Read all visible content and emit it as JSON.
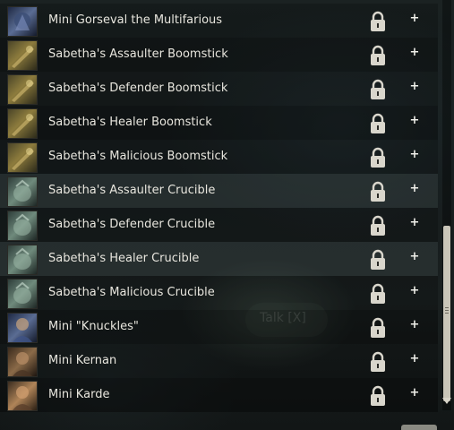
{
  "world": {
    "talk_prompt": "Talk [X]"
  },
  "items": [
    {
      "name": "Mini Gorseval the Multifarious",
      "icon": "gorseval-icon",
      "tone": "blue"
    },
    {
      "name": "Sabetha's Assaulter Boomstick",
      "icon": "boomstick-icon",
      "tone": "gold"
    },
    {
      "name": "Sabetha's Defender Boomstick",
      "icon": "boomstick-icon",
      "tone": "gold"
    },
    {
      "name": "Sabetha's Healer Boomstick",
      "icon": "boomstick-icon",
      "tone": "gold"
    },
    {
      "name": "Sabetha's Malicious Boomstick",
      "icon": "boomstick-icon",
      "tone": "gold"
    },
    {
      "name": "Sabetha's Assaulter Crucible",
      "icon": "crucible-icon",
      "tone": "teal"
    },
    {
      "name": "Sabetha's Defender Crucible",
      "icon": "crucible-icon",
      "tone": "teal"
    },
    {
      "name": "Sabetha's Healer Crucible",
      "icon": "crucible-icon",
      "tone": "teal"
    },
    {
      "name": "Sabetha's Malicious Crucible",
      "icon": "crucible-icon",
      "tone": "teal"
    },
    {
      "name": "Mini \"Knuckles\"",
      "icon": "knuckles-portrait-icon",
      "tone": "blue"
    },
    {
      "name": "Mini Kernan",
      "icon": "kernan-portrait-icon",
      "tone": "brown"
    },
    {
      "name": "Mini Karde",
      "icon": "karde-portrait-icon",
      "tone": "skin"
    }
  ],
  "row_action": {
    "lock_icon": "padlock-icon",
    "add_label": "+"
  },
  "colors": {
    "text": "#e8e6de",
    "scroll_thumb": "#c9c5b8"
  }
}
